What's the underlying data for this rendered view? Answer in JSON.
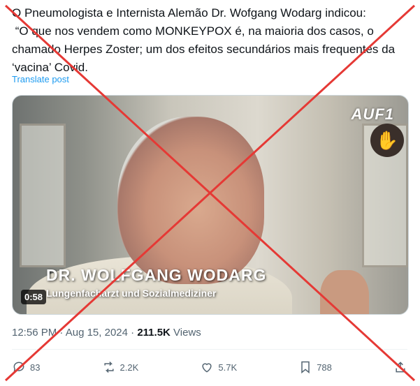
{
  "tweet": {
    "line1": "O Pneumologista e Internista Alemão  Dr. Wofgang Wodarg indicou:",
    "line2": " “O que nos vendem como MONKEYPOX é, na maioria dos casos, o",
    "line3": "chamado Herpes Zoster; um dos efeitos secundários mais frequentes da",
    "line4": "‘vacina’ Covid.",
    "translate_label": "Translate post"
  },
  "media": {
    "channel_logo": "AUF1",
    "lower_third_name": "DR. WOLFGANG WODARG",
    "lower_third_subtitle": "Lungenfacharzt und Sozialmediziner",
    "duration": "0:58"
  },
  "meta": {
    "time": "12:56 PM",
    "separator": "·",
    "date": "Aug 15, 2024",
    "views_count": "211.5K",
    "views_label": "Views"
  },
  "actions": {
    "replies": "83",
    "reposts": "2.2K",
    "likes": "5.7K",
    "bookmarks": "788"
  },
  "icons": [
    "reply-icon",
    "repost-icon",
    "like-icon",
    "bookmark-icon",
    "share-icon"
  ],
  "colors": {
    "link": "#1d9bf0",
    "muted": "#536471",
    "cross": "#e53935"
  }
}
